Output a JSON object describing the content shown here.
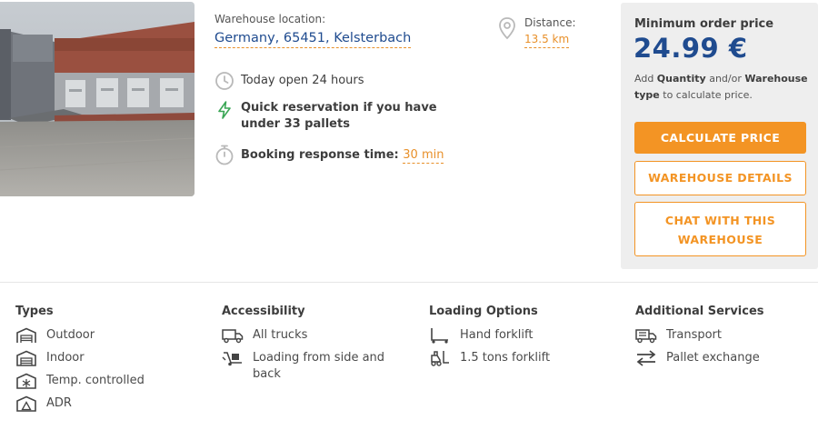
{
  "location": {
    "label": "Warehouse location:",
    "value": "Germany, 65451, Kelsterbach"
  },
  "distance": {
    "label": "Distance:",
    "value": "13.5 km"
  },
  "features": {
    "open": "Today open 24 hours",
    "quick": "Quick reservation if you have under 33 pallets",
    "response_label": "Booking response time:",
    "response_value": "30 min"
  },
  "pricing": {
    "min_label": "Minimum order price",
    "price": "24.99 €",
    "hint_add": "Add",
    "hint_quantity": "Quantity",
    "hint_andor": "and/or",
    "hint_warehouse": "Warehouse type",
    "hint_rest": "to calculate price."
  },
  "buttons": {
    "calculate": "CALCULATE PRICE",
    "details": "WAREHOUSE DETAILS",
    "chat_line1": "CHAT WITH THIS",
    "chat_line2": "WAREHOUSE"
  },
  "types": {
    "title": "Types",
    "items": [
      "Outdoor",
      "Indoor",
      "Temp. controlled",
      "ADR"
    ]
  },
  "accessibility": {
    "title": "Accessibility",
    "items": [
      "All trucks",
      "Loading from side and back"
    ]
  },
  "loading": {
    "title": "Loading Options",
    "items": [
      "Hand forklift",
      "1.5 tons forklift"
    ]
  },
  "services": {
    "title": "Additional Services",
    "items": [
      "Transport",
      "Pallet exchange"
    ]
  },
  "colors": {
    "accent": "#f39424",
    "brand_blue": "#1f4b8f",
    "panel_bg": "#eeeeee",
    "green": "#3aa655"
  }
}
